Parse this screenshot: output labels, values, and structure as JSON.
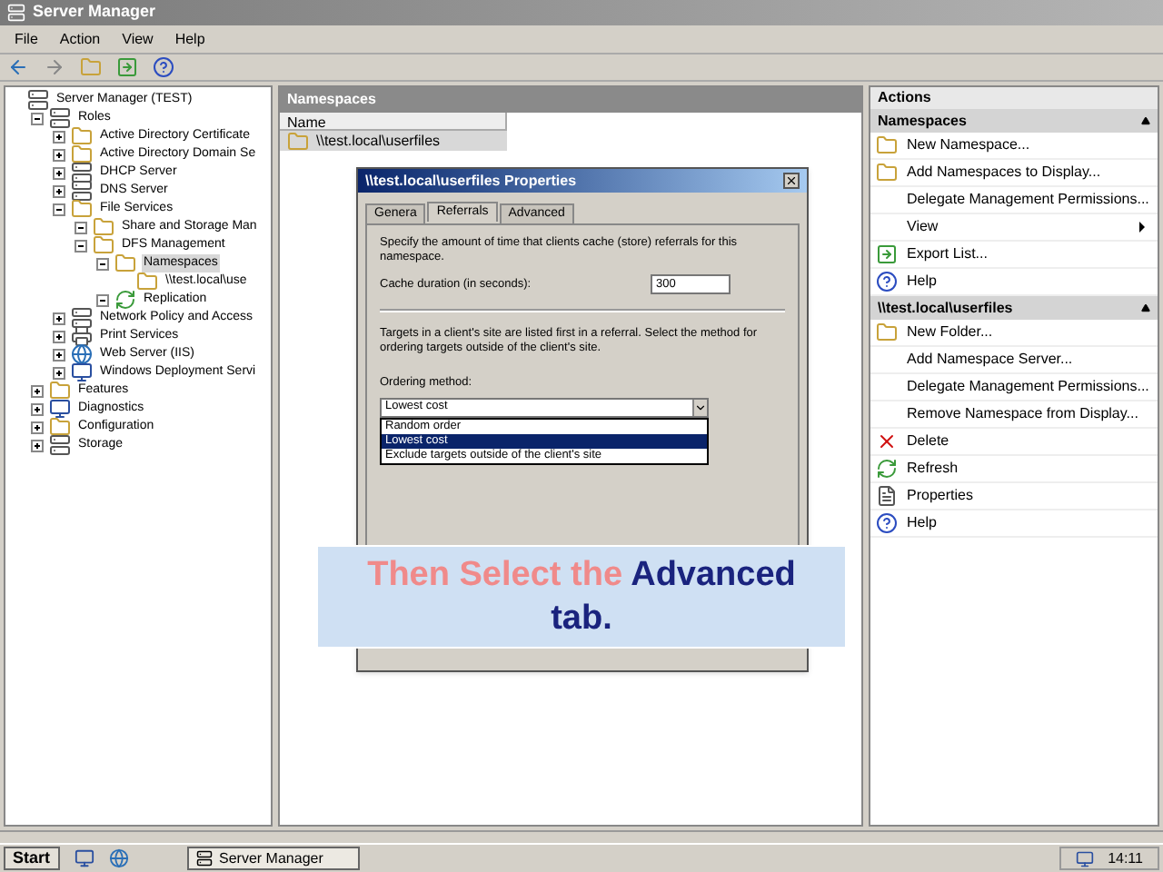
{
  "window": {
    "title": "Server Manager"
  },
  "menu": [
    "File",
    "Action",
    "View",
    "Help"
  ],
  "tree": [
    {
      "label": "Server Manager (TEST)",
      "kind": "server",
      "children": [
        {
          "label": "Roles",
          "kind": "server",
          "expanded": true,
          "children": [
            {
              "label": "Active Directory Certificate",
              "kind": "folder",
              "expanded": false
            },
            {
              "label": "Active Directory Domain Se",
              "kind": "folder",
              "expanded": false
            },
            {
              "label": "DHCP Server",
              "kind": "server",
              "expanded": false
            },
            {
              "label": "DNS Server",
              "kind": "server",
              "expanded": false
            },
            {
              "label": "File Services",
              "kind": "folder",
              "expanded": true,
              "children": [
                {
                  "label": "Share and Storage Man",
                  "kind": "folder",
                  "expanded": true
                },
                {
                  "label": "DFS Management",
                  "kind": "folder",
                  "expanded": true,
                  "children": [
                    {
                      "label": "Namespaces",
                      "kind": "folder",
                      "expanded": true,
                      "selected": true,
                      "children": [
                        {
                          "label": "\\\\test.local\\use",
                          "kind": "folder"
                        }
                      ]
                    },
                    {
                      "label": "Replication",
                      "kind": "refresh",
                      "expanded": true
                    }
                  ]
                }
              ]
            },
            {
              "label": "Network Policy and Access",
              "kind": "server",
              "expanded": false
            },
            {
              "label": "Print Services",
              "kind": "printer",
              "expanded": false
            },
            {
              "label": "Web Server (IIS)",
              "kind": "globe",
              "expanded": false
            },
            {
              "label": "Windows Deployment Servi",
              "kind": "monitor",
              "expanded": false
            }
          ]
        },
        {
          "label": "Features",
          "kind": "folder",
          "expanded": false
        },
        {
          "label": "Diagnostics",
          "kind": "monitor",
          "expanded": false
        },
        {
          "label": "Configuration",
          "kind": "folder",
          "expanded": false
        },
        {
          "label": "Storage",
          "kind": "server",
          "expanded": false
        }
      ]
    }
  ],
  "center": {
    "header": "Namespaces",
    "columns": [
      "Name"
    ],
    "rows": [
      {
        "name": "\\\\test.local\\userfiles",
        "selected": true
      }
    ]
  },
  "actions": {
    "title": "Actions",
    "sections": [
      {
        "title": "Namespaces",
        "items": [
          {
            "label": "New Namespace...",
            "kind": "folder"
          },
          {
            "label": "Add Namespaces to Display...",
            "kind": "folder"
          },
          {
            "label": "Delegate Management Permissions...",
            "kind": "none"
          },
          {
            "label": "View",
            "kind": "none",
            "submenu": true
          },
          {
            "label": "Export List...",
            "kind": "export"
          },
          {
            "label": "Help",
            "kind": "help"
          }
        ]
      },
      {
        "title": "\\\\test.local\\userfiles",
        "items": [
          {
            "label": "New Folder...",
            "kind": "folder"
          },
          {
            "label": "Add Namespace Server...",
            "kind": "none"
          },
          {
            "label": "Delegate Management Permissions...",
            "kind": "none"
          },
          {
            "label": "Remove Namespace from Display...",
            "kind": "none"
          },
          {
            "label": "Delete",
            "kind": "delete"
          },
          {
            "label": "Refresh",
            "kind": "refresh"
          },
          {
            "label": "Properties",
            "kind": "doc"
          },
          {
            "label": "Help",
            "kind": "help"
          }
        ]
      }
    ]
  },
  "dialog": {
    "title": "\\\\test.local\\userfiles Properties",
    "tabs": [
      {
        "label": "Genera",
        "selected": false
      },
      {
        "label": "Referrals",
        "selected": true
      },
      {
        "label": "Advanced",
        "selected": false
      }
    ],
    "description": "Specify the amount of time that clients cache (store) referrals for this namespace.",
    "cache_label": "Cache duration (in seconds):",
    "cache_value": "300",
    "targets_text": "Targets in a client's site are listed first in a referral. Select the method for ordering targets outside of the client's site.",
    "ordering_label": "Ordering method:",
    "ordering_value": "Lowest cost",
    "options": [
      {
        "label": "Random order",
        "selected": false
      },
      {
        "label": "Lowest cost",
        "selected": true
      },
      {
        "label": "Exclude targets outside of the client's site",
        "selected": false
      }
    ]
  },
  "caption": {
    "parts": [
      {
        "text": "Then Select the",
        "kind": "plain"
      },
      {
        "text": "Advanced",
        "kind": "highlight"
      },
      {
        "text": "tab.",
        "kind": "highlight"
      }
    ]
  },
  "taskbar": {
    "start": "Start",
    "tasks": [
      {
        "label": "Server Manager",
        "selected": true
      }
    ],
    "clock": "14:11"
  }
}
